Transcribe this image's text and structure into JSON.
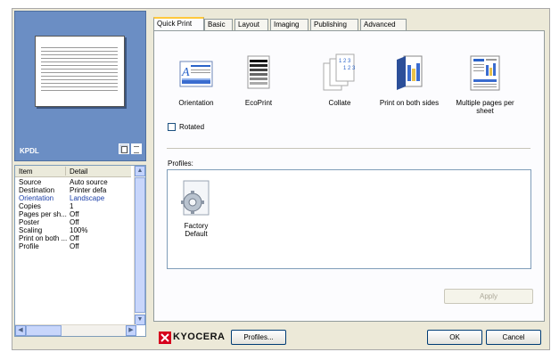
{
  "preview": {
    "label": "KPDL"
  },
  "summary": {
    "headers": [
      "Item",
      "Detail"
    ],
    "rows": [
      {
        "item": "Source",
        "detail": "Auto source"
      },
      {
        "item": "Destination",
        "detail": "Printer defa"
      },
      {
        "item": "Orientation",
        "detail": "Landscape"
      },
      {
        "item": "Copies",
        "detail": "1"
      },
      {
        "item": "Pages per sh...",
        "detail": "Off"
      },
      {
        "item": "Poster",
        "detail": "Off"
      },
      {
        "item": "Scaling",
        "detail": "100%"
      },
      {
        "item": "Print on both ...",
        "detail": "Off"
      },
      {
        "item": "Profile",
        "detail": "Off"
      }
    ]
  },
  "tabs": [
    "Quick Print",
    "Basic",
    "Layout",
    "Imaging",
    "Publishing",
    "Advanced"
  ],
  "quick_print": {
    "items": [
      "Orientation",
      "EcoPrint",
      "Collate",
      "Print on both sides",
      "Multiple pages per sheet"
    ],
    "rotated_label": "Rotated",
    "rotated_checked": false
  },
  "profiles": {
    "label": "Profiles:",
    "items": [
      "Factory Default"
    ]
  },
  "buttons": {
    "apply": "Apply",
    "profiles": "Profiles...",
    "ok": "OK",
    "cancel": "Cancel"
  },
  "brand": {
    "name": "KYOCERA",
    "color": "#d6001c"
  },
  "colors": {
    "preview_bg": "#6b8ec4",
    "active_tab_accent": "#ffc83c"
  }
}
